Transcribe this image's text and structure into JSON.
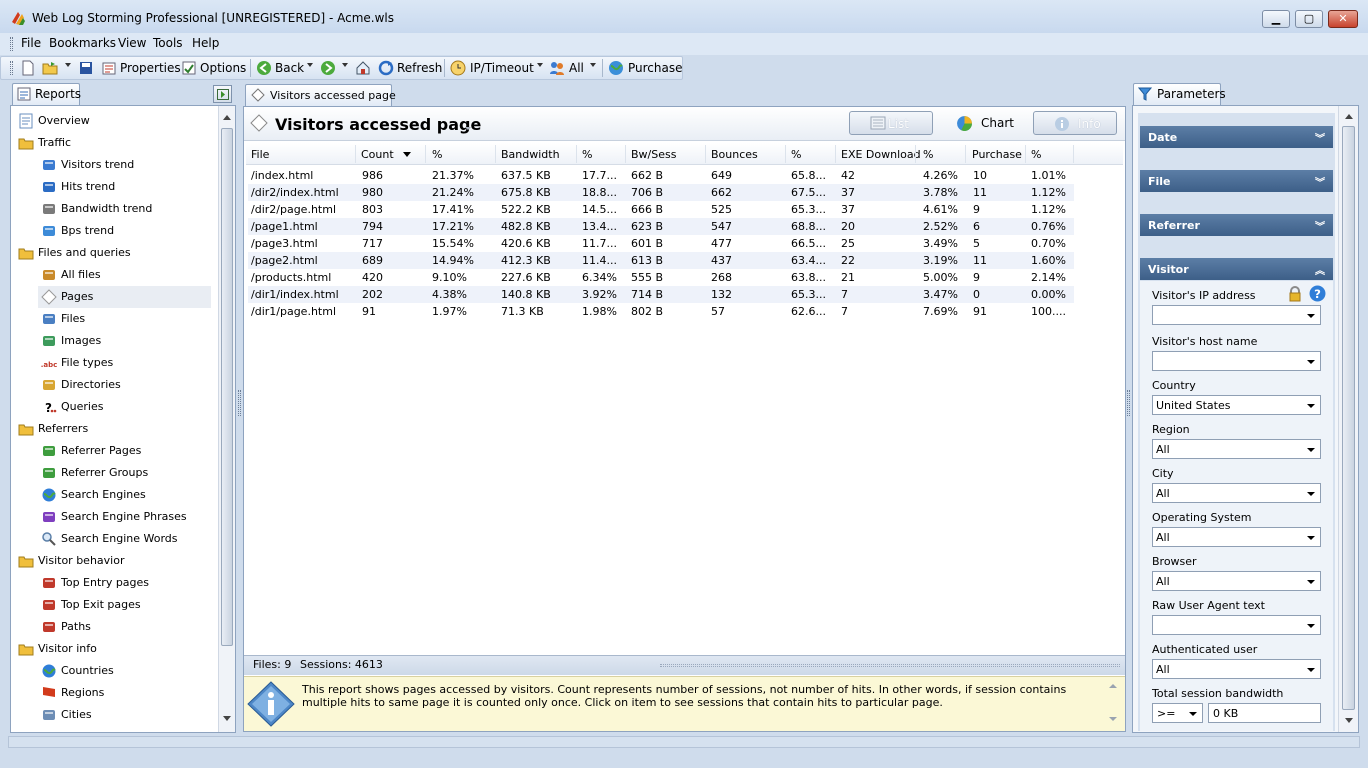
{
  "window": {
    "title": "Web Log Storming Professional [UNREGISTERED] - Acme.wls"
  },
  "menu": [
    "File",
    "Bookmarks",
    "View",
    "Tools",
    "Help"
  ],
  "toolbar": {
    "properties": "Properties",
    "options": "Options",
    "back": "Back",
    "refresh": "Refresh",
    "ip_timeout": "IP/Timeout",
    "all": "All",
    "purchase": "Purchase"
  },
  "reports": {
    "tab": "Reports",
    "items": [
      {
        "label": "Overview",
        "level": 0,
        "icon": "document-icon"
      },
      {
        "label": "Traffic",
        "level": 0,
        "icon": "folder-icon"
      },
      {
        "label": "Visitors trend",
        "level": 1,
        "icon": "visitors-icon"
      },
      {
        "label": "Hits trend",
        "level": 1,
        "icon": "cursor-icon"
      },
      {
        "label": "Bandwidth trend",
        "level": 1,
        "icon": "anvil-icon"
      },
      {
        "label": "Bps trend",
        "level": 1,
        "icon": "speed-icon"
      },
      {
        "label": "Files and queries",
        "level": 0,
        "icon": "folder-icon"
      },
      {
        "label": "All files",
        "level": 1,
        "icon": "box-icon"
      },
      {
        "label": "Pages",
        "level": 1,
        "icon": "page-icon",
        "selected": true
      },
      {
        "label": "Files",
        "level": 1,
        "icon": "files-icon"
      },
      {
        "label": "Images",
        "level": 1,
        "icon": "image-icon"
      },
      {
        "label": "File types",
        "level": 1,
        "icon": "abc-icon"
      },
      {
        "label": "Directories",
        "level": 1,
        "icon": "directory-icon"
      },
      {
        "label": "Queries",
        "level": 1,
        "icon": "question-icon"
      },
      {
        "label": "Referrers",
        "level": 0,
        "icon": "folder-icon"
      },
      {
        "label": "Referrer Pages",
        "level": 1,
        "icon": "referrer-page-icon"
      },
      {
        "label": "Referrer Groups",
        "level": 1,
        "icon": "referrer-group-icon"
      },
      {
        "label": "Search Engines",
        "level": 1,
        "icon": "globe-icon"
      },
      {
        "label": "Search Engine Phrases",
        "level": 1,
        "icon": "phrase-icon"
      },
      {
        "label": "Search Engine Words",
        "level": 1,
        "icon": "magnifier-icon"
      },
      {
        "label": "Visitor behavior",
        "level": 0,
        "icon": "folder-icon"
      },
      {
        "label": "Top Entry pages",
        "level": 1,
        "icon": "entry-icon"
      },
      {
        "label": "Top Exit pages",
        "level": 1,
        "icon": "exit-icon"
      },
      {
        "label": "Paths",
        "level": 1,
        "icon": "paths-icon"
      },
      {
        "label": "Visitor info",
        "level": 0,
        "icon": "folder-icon"
      },
      {
        "label": "Countries",
        "level": 1,
        "icon": "globe-icon"
      },
      {
        "label": "Regions",
        "level": 1,
        "icon": "flag-icon"
      },
      {
        "label": "Cities",
        "level": 1,
        "icon": "city-icon"
      }
    ]
  },
  "content": {
    "tab": "Visitors accessed page",
    "title": "Visitors accessed page",
    "buttons": {
      "list": "List",
      "chart": "Chart",
      "info": "Info"
    },
    "columns": [
      "File",
      "Count",
      "%",
      "Bandwidth",
      "%",
      "Bw/Sess",
      "Bounces",
      "%",
      "EXE Download",
      "%",
      "Purchase",
      "%"
    ],
    "rows": [
      [
        "/index.html",
        "986",
        "21.37%",
        "637.5 KB",
        "17.7...",
        "662 B",
        "649",
        "65.8...",
        "42",
        "4.26%",
        "10",
        "1.01%"
      ],
      [
        "/dir2/index.html",
        "980",
        "21.24%",
        "675.8 KB",
        "18.8...",
        "706 B",
        "662",
        "67.5...",
        "37",
        "3.78%",
        "11",
        "1.12%"
      ],
      [
        "/dir2/page.html",
        "803",
        "17.41%",
        "522.2 KB",
        "14.5...",
        "666 B",
        "525",
        "65.3...",
        "37",
        "4.61%",
        "9",
        "1.12%"
      ],
      [
        "/page1.html",
        "794",
        "17.21%",
        "482.8 KB",
        "13.4...",
        "623 B",
        "547",
        "68.8...",
        "20",
        "2.52%",
        "6",
        "0.76%"
      ],
      [
        "/page3.html",
        "717",
        "15.54%",
        "420.6 KB",
        "11.7...",
        "601 B",
        "477",
        "66.5...",
        "25",
        "3.49%",
        "5",
        "0.70%"
      ],
      [
        "/page2.html",
        "689",
        "14.94%",
        "412.3 KB",
        "11.4...",
        "613 B",
        "437",
        "63.4...",
        "22",
        "3.19%",
        "11",
        "1.60%"
      ],
      [
        "/products.html",
        "420",
        "9.10%",
        "227.6 KB",
        "6.34%",
        "555 B",
        "268",
        "63.8...",
        "21",
        "5.00%",
        "9",
        "2.14%"
      ],
      [
        "/dir1/index.html",
        "202",
        "4.38%",
        "140.8 KB",
        "3.92%",
        "714 B",
        "132",
        "65.3...",
        "7",
        "3.47%",
        "0",
        "0.00%"
      ],
      [
        "/dir1/page.html",
        "91",
        "1.97%",
        "71.3 KB",
        "1.98%",
        "802 B",
        "57",
        "62.6...",
        "7",
        "7.69%",
        "91",
        "100...."
      ]
    ],
    "status": {
      "files": "Files: 9",
      "sessions": "Sessions: 4613"
    },
    "info_text": "This report shows pages accessed by visitors. Count represents number of sessions, not number of hits. In other words, if session contains multiple hits to same page it is counted only once. Click on item to see sessions that contain hits to particular page."
  },
  "parameters": {
    "tab": "Parameters",
    "sections": [
      {
        "label": "Date",
        "collapsed": true
      },
      {
        "label": "File",
        "collapsed": true
      },
      {
        "label": "Referrer",
        "collapsed": true
      },
      {
        "label": "Visitor",
        "collapsed": false
      }
    ],
    "fields": [
      {
        "label": "Visitor's IP address",
        "value": ""
      },
      {
        "label": "Visitor's host name",
        "value": ""
      },
      {
        "label": "Country",
        "value": "United States"
      },
      {
        "label": "Region",
        "value": "All"
      },
      {
        "label": "City",
        "value": "All"
      },
      {
        "label": "Operating System",
        "value": "All"
      },
      {
        "label": "Browser",
        "value": "All"
      },
      {
        "label": "Raw User Agent text",
        "value": ""
      },
      {
        "label": "Authenticated user",
        "value": "All"
      }
    ],
    "bandwidth": {
      "label": "Total session bandwidth",
      "operator": ">=",
      "value": "0 KB"
    }
  }
}
